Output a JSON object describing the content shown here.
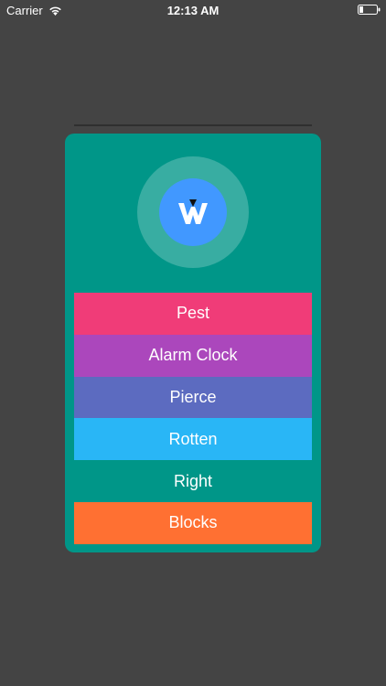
{
  "status_bar": {
    "carrier": "Carrier",
    "time": "12:13 AM",
    "wifi_icon": "wifi-icon",
    "battery_icon": "battery-icon"
  },
  "card": {
    "background": "#009688",
    "avatar_icon": "w-logo-icon",
    "avatar_color": "#4198ff"
  },
  "menu": [
    {
      "label": "Pest",
      "color": "#f03c78"
    },
    {
      "label": "Alarm Clock",
      "color": "#ab47bc"
    },
    {
      "label": "Pierce",
      "color": "#5c6bc0"
    },
    {
      "label": "Rotten",
      "color": "#29b6f6"
    },
    {
      "label": "Right",
      "color": "#009688"
    },
    {
      "label": "Blocks",
      "color": "#ff7032"
    }
  ]
}
